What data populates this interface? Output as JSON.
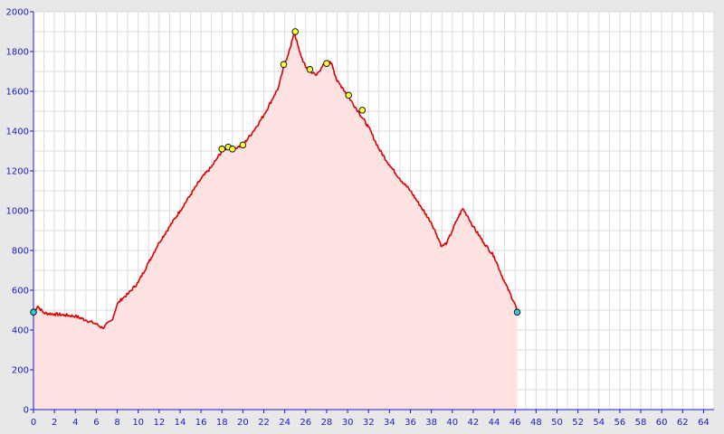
{
  "chart_data": {
    "type": "area",
    "title": "",
    "xlabel": "",
    "ylabel": "",
    "xlim": [
      0,
      65
    ],
    "ylim": [
      0,
      2000
    ],
    "x_ticks": [
      0,
      2,
      4,
      6,
      8,
      10,
      12,
      14,
      16,
      18,
      20,
      22,
      24,
      26,
      28,
      30,
      32,
      34,
      36,
      38,
      40,
      42,
      44,
      46,
      48,
      50,
      52,
      54,
      56,
      58,
      60,
      62,
      64
    ],
    "y_ticks": [
      0,
      200,
      400,
      600,
      800,
      1000,
      1200,
      1400,
      1600,
      1800,
      2000
    ],
    "grid": true,
    "colors": {
      "line": "#dd0000",
      "fill": "#ffe2e2",
      "plot_background": "#ffffff",
      "page_background": "#e8e8e8",
      "grid": "#d9d9d9",
      "axis": "#1a1acc",
      "tick_text": "#1a1acc",
      "waypoint": "#ffff33",
      "endpoint": "#33ccdd"
    },
    "series": [
      {
        "x": [
          0,
          0.4,
          1,
          2,
          3,
          4,
          5,
          6,
          6.6,
          7.5,
          8,
          8.5,
          9,
          10,
          11,
          12,
          13,
          14,
          15,
          16,
          17,
          17.5,
          18,
          18.6,
          19,
          19.5,
          20,
          21,
          22,
          23,
          23.4,
          24,
          24.6,
          24.9,
          25.4,
          26,
          26.5,
          27,
          27.5,
          28,
          28.5,
          29,
          29.5,
          30,
          31,
          32,
          33,
          34,
          35,
          36,
          37,
          38,
          38.5,
          39,
          39.5,
          40,
          40.5,
          41,
          41.5,
          42,
          43,
          44,
          45,
          46,
          46.2
        ],
        "values": [
          490,
          520,
          485,
          480,
          475,
          470,
          450,
          430,
          410,
          450,
          530,
          560,
          580,
          640,
          740,
          840,
          920,
          1000,
          1080,
          1160,
          1220,
          1260,
          1300,
          1320,
          1310,
          1320,
          1330,
          1400,
          1480,
          1580,
          1620,
          1740,
          1830,
          1900,
          1800,
          1720,
          1700,
          1680,
          1720,
          1750,
          1740,
          1650,
          1620,
          1580,
          1500,
          1420,
          1310,
          1230,
          1160,
          1100,
          1020,
          940,
          880,
          820,
          840,
          900,
          960,
          1010,
          970,
          920,
          840,
          770,
          640,
          530,
          490
        ]
      }
    ],
    "waypoints": [
      {
        "x": 18.0,
        "y": 1310
      },
      {
        "x": 18.6,
        "y": 1320
      },
      {
        "x": 19.0,
        "y": 1310
      },
      {
        "x": 20.0,
        "y": 1330
      },
      {
        "x": 23.9,
        "y": 1735
      },
      {
        "x": 25.0,
        "y": 1900
      },
      {
        "x": 26.4,
        "y": 1710
      },
      {
        "x": 28.0,
        "y": 1740
      },
      {
        "x": 30.1,
        "y": 1580
      },
      {
        "x": 31.4,
        "y": 1505
      }
    ],
    "endpoints": [
      {
        "x": 0,
        "y": 490
      },
      {
        "x": 46.2,
        "y": 490
      }
    ]
  }
}
